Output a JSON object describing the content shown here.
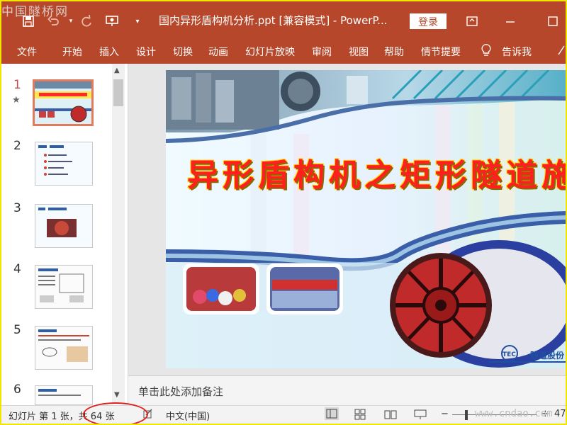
{
  "watermark_top": "中国隧桥网",
  "watermark_bottom": "www.cndao.com",
  "titlebar": {
    "title": "国内异形盾构机分析.ppt [兼容模式] - PowerP...",
    "login_label": "登录"
  },
  "ribbon": {
    "tabs": [
      "文件",
      "开始",
      "插入",
      "设计",
      "切换",
      "动画",
      "幻灯片放映",
      "审阅",
      "视图",
      "帮助",
      "情节提要",
      "告诉我"
    ]
  },
  "thumbnails": {
    "numbers": [
      "1",
      "2",
      "3",
      "4",
      "5",
      "6"
    ]
  },
  "slide": {
    "title": "异形盾构机之矩形隧道施工技术",
    "company_badge": "TEC",
    "company_name": "隧道股份"
  },
  "notes": {
    "placeholder": "单击此处添加备注"
  },
  "status": {
    "slide_indicator": "幻灯片 第 1 张，共 64 张",
    "language": "中文(中国)",
    "zoom_tail": "47"
  },
  "colors": {
    "accent": "#b7472a",
    "highlight_border": "#f2e600",
    "annotation_circle": "#e02020"
  }
}
